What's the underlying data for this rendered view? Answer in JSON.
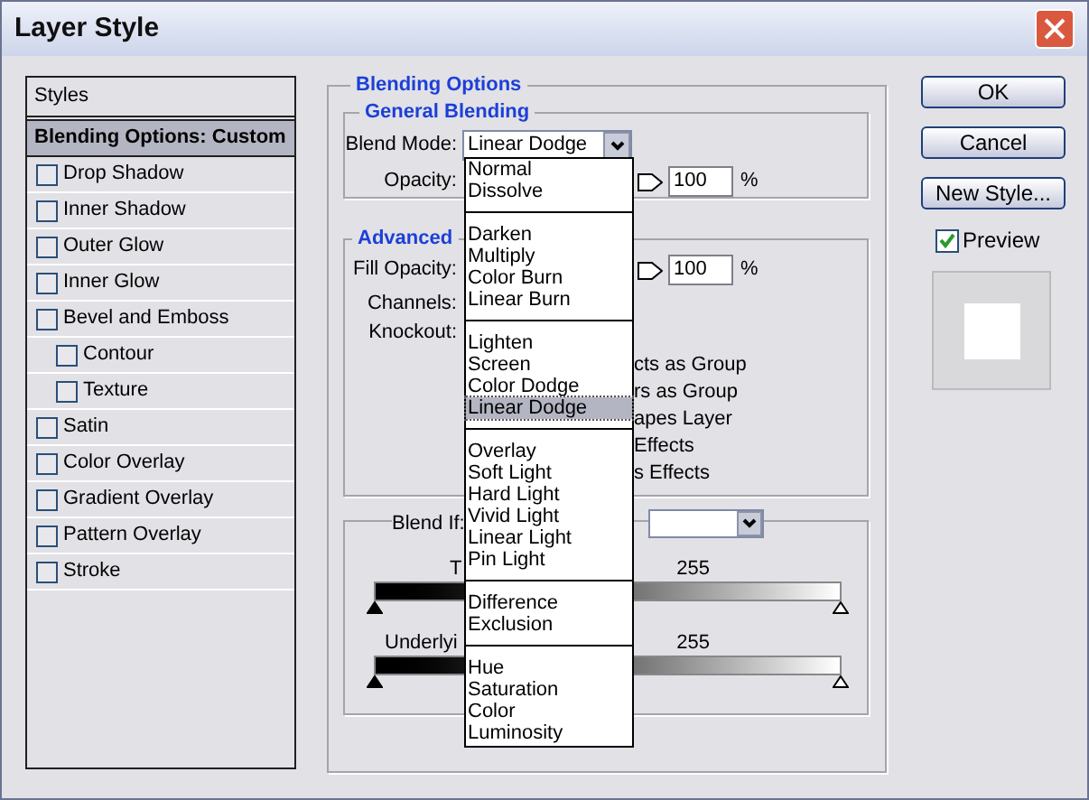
{
  "window": {
    "title": "Layer Style"
  },
  "styles_panel": {
    "header": "Styles",
    "items": [
      {
        "label": "Blending Options: Custom",
        "kind": "heading",
        "selected": true
      },
      {
        "label": "Drop Shadow",
        "kind": "checkbox",
        "checked": false,
        "selected": false
      },
      {
        "label": "Inner Shadow",
        "kind": "checkbox",
        "checked": false,
        "selected": false
      },
      {
        "label": "Outer Glow",
        "kind": "checkbox",
        "checked": false,
        "selected": false
      },
      {
        "label": "Inner Glow",
        "kind": "checkbox",
        "checked": false,
        "selected": false
      },
      {
        "label": "Bevel and Emboss",
        "kind": "checkbox",
        "checked": false,
        "selected": false,
        "children": [
          {
            "label": "Contour",
            "kind": "checkbox",
            "checked": false,
            "selected": false
          },
          {
            "label": "Texture",
            "kind": "checkbox",
            "checked": false,
            "selected": false
          }
        ]
      },
      {
        "label": "Satin",
        "kind": "checkbox",
        "checked": false,
        "selected": false
      },
      {
        "label": "Color Overlay",
        "kind": "checkbox",
        "checked": false,
        "selected": false
      },
      {
        "label": "Gradient Overlay",
        "kind": "checkbox",
        "checked": false,
        "selected": false
      },
      {
        "label": "Pattern Overlay",
        "kind": "checkbox",
        "checked": false,
        "selected": false
      },
      {
        "label": "Stroke",
        "kind": "checkbox",
        "checked": false,
        "selected": false
      }
    ]
  },
  "blending_options": {
    "title": "Blending Options",
    "general": {
      "title": "General Blending",
      "blend_mode": {
        "label": "Blend Mode:",
        "value": "Linear Dodge",
        "expanded": true
      },
      "opacity": {
        "label": "Opacity:",
        "value": "100",
        "unit": "%"
      }
    },
    "advanced": {
      "title": "Advanced",
      "fill_opacity": {
        "label": "Fill Opacity:",
        "value": "100",
        "unit": "%"
      },
      "channels_label": "Channels:",
      "knockout_label": "Knockout:",
      "option_fragments": [
        "cts as Group",
        "rs as Group",
        "apes Layer",
        "Effects",
        "s Effects"
      ]
    },
    "blend_if": {
      "label": "Blend If:",
      "this_layer": {
        "label": "T",
        "max": "255"
      },
      "underlying": {
        "label": "Underlyi",
        "max": "255"
      }
    }
  },
  "blend_mode_menu": {
    "groups": [
      {
        "items": [
          {
            "label": "Normal",
            "selected": false
          },
          {
            "label": "Dissolve",
            "selected": false
          }
        ]
      },
      {
        "items": [
          {
            "label": "Darken",
            "selected": false
          },
          {
            "label": "Multiply",
            "selected": false
          },
          {
            "label": "Color Burn",
            "selected": false
          },
          {
            "label": "Linear Burn",
            "selected": false
          }
        ]
      },
      {
        "items": [
          {
            "label": "Lighten",
            "selected": false
          },
          {
            "label": "Screen",
            "selected": false
          },
          {
            "label": "Color Dodge",
            "selected": false
          },
          {
            "label": "Linear Dodge",
            "selected": true
          }
        ]
      },
      {
        "items": [
          {
            "label": "Overlay",
            "selected": false
          },
          {
            "label": "Soft Light",
            "selected": false
          },
          {
            "label": "Hard Light",
            "selected": false
          },
          {
            "label": "Vivid Light",
            "selected": false
          },
          {
            "label": "Linear Light",
            "selected": false
          },
          {
            "label": "Pin Light",
            "selected": false
          }
        ]
      },
      {
        "items": [
          {
            "label": "Difference",
            "selected": false
          },
          {
            "label": "Exclusion",
            "selected": false
          }
        ]
      },
      {
        "items": [
          {
            "label": "Hue",
            "selected": false
          },
          {
            "label": "Saturation",
            "selected": false
          },
          {
            "label": "Color",
            "selected": false
          },
          {
            "label": "Luminosity",
            "selected": false
          }
        ]
      }
    ]
  },
  "buttons": [
    {
      "label": "OK"
    },
    {
      "label": "Cancel"
    },
    {
      "label": "New Style..."
    }
  ],
  "preview": {
    "label": "Preview",
    "checked": true
  }
}
